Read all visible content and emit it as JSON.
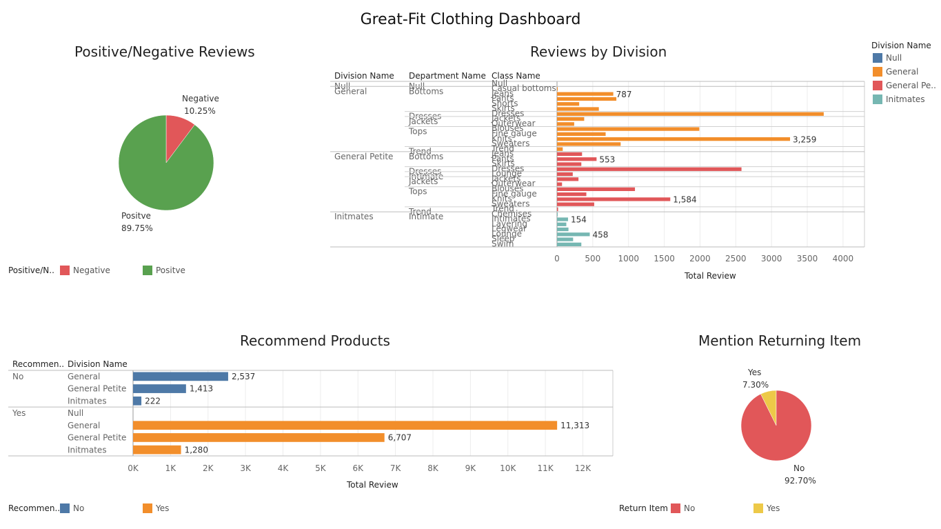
{
  "dashboard_title": "Great-Fit Clothing Dashboard",
  "colors": {
    "null": "#4e79a7",
    "general": "#f28e2b",
    "petite": "#e15759",
    "intimates": "#76b7b2",
    "positive": "#59a14f",
    "negative": "#e15759",
    "yes_return": "#edc948"
  },
  "division_legend": {
    "title": "Division Name",
    "items": [
      {
        "label": "Null",
        "color": "#4e79a7"
      },
      {
        "label": "General",
        "color": "#f28e2b"
      },
      {
        "label": "General Pe..",
        "color": "#e15759"
      },
      {
        "label": "Initmates",
        "color": "#76b7b2"
      }
    ]
  },
  "chart_data": [
    {
      "id": "pos_neg",
      "type": "pie",
      "title": "Positive/Negative Reviews",
      "slices": [
        {
          "label": "Negative",
          "value": 10.25,
          "display": "10.25%",
          "color": "#e15759"
        },
        {
          "label": "Positve",
          "value": 89.75,
          "display": "89.75%",
          "color": "#59a14f"
        }
      ],
      "legend": {
        "title": "Positive/N..",
        "items": [
          {
            "label": "Negative",
            "color": "#e15759"
          },
          {
            "label": "Positve",
            "color": "#59a14f"
          }
        ]
      }
    },
    {
      "id": "division",
      "type": "bar",
      "title": "Reviews by Division",
      "headers": [
        "Division Name",
        "Department Name",
        "Class Name"
      ],
      "xlabel": "Total Review",
      "xlim": [
        0,
        4300
      ],
      "ticks": [
        0,
        500,
        1000,
        1500,
        2000,
        2500,
        3000,
        3500,
        4000
      ],
      "divisions": [
        {
          "name": "Null",
          "color": "#4e79a7",
          "departments": [
            {
              "name": "Null",
              "classes": [
                {
                  "name": "Null",
                  "value": 0
                }
              ]
            }
          ]
        },
        {
          "name": "General",
          "color": "#f28e2b",
          "departments": [
            {
              "name": "Bottoms",
              "classes": [
                {
                  "name": "Casual bottoms",
                  "value": 2
                },
                {
                  "name": "Jeans",
                  "value": 787,
                  "label": "787"
                },
                {
                  "name": "Pants",
                  "value": 830
                },
                {
                  "name": "Shorts",
                  "value": 310
                },
                {
                  "name": "Skirts",
                  "value": 585
                }
              ]
            },
            {
              "name": "Dresses",
              "classes": [
                {
                  "name": "Dresses",
                  "value": 3730
                }
              ]
            },
            {
              "name": "Jackets",
              "classes": [
                {
                  "name": "Jackets",
                  "value": 380
                },
                {
                  "name": "Outerwear",
                  "value": 240
                }
              ]
            },
            {
              "name": "Tops",
              "classes": [
                {
                  "name": "Blouses",
                  "value": 1990
                },
                {
                  "name": "Fine gauge",
                  "value": 680
                },
                {
                  "name": "Knits",
                  "value": 3259,
                  "label": "3,259"
                },
                {
                  "name": "Sweaters",
                  "value": 890
                }
              ]
            },
            {
              "name": "Trend",
              "classes": [
                {
                  "name": "Trend",
                  "value": 80
                }
              ]
            }
          ]
        },
        {
          "name": "General Petite",
          "color": "#e15759",
          "departments": [
            {
              "name": "Bottoms",
              "classes": [
                {
                  "name": "Jeans",
                  "value": 350
                },
                {
                  "name": "Pants",
                  "value": 553,
                  "label": "553"
                },
                {
                  "name": "Skirts",
                  "value": 340
                }
              ]
            },
            {
              "name": "Dresses",
              "classes": [
                {
                  "name": "Dresses",
                  "value": 2580
                }
              ]
            },
            {
              "name": "Intimate",
              "classes": [
                {
                  "name": "Lounge",
                  "value": 220
                }
              ]
            },
            {
              "name": "Jackets",
              "classes": [
                {
                  "name": "Jackets",
                  "value": 300
                },
                {
                  "name": "Outerwear",
                  "value": 70
                }
              ]
            },
            {
              "name": "Tops",
              "classes": [
                {
                  "name": "Blouses",
                  "value": 1090
                },
                {
                  "name": "Fine gauge",
                  "value": 410
                },
                {
                  "name": "Knits",
                  "value": 1584,
                  "label": "1,584"
                },
                {
                  "name": "Sweaters",
                  "value": 520
                }
              ]
            },
            {
              "name": "Trend",
              "classes": [
                {
                  "name": "Trend",
                  "value": 15
                }
              ]
            }
          ]
        },
        {
          "name": "Initmates",
          "color": "#76b7b2",
          "departments": [
            {
              "name": "Intimate",
              "classes": [
                {
                  "name": "Chemises",
                  "value": 2
                },
                {
                  "name": "Intimates",
                  "value": 154,
                  "label": "154"
                },
                {
                  "name": "Layering",
                  "value": 130
                },
                {
                  "name": "Legwear",
                  "value": 160
                },
                {
                  "name": "Lounge",
                  "value": 458,
                  "label": "458"
                },
                {
                  "name": "Sleep",
                  "value": 225
                },
                {
                  "name": "Swim",
                  "value": 340
                }
              ]
            }
          ]
        }
      ]
    },
    {
      "id": "recommend",
      "type": "bar",
      "title": "Recommend Products",
      "headers": [
        "Recommen..",
        "Division Name"
      ],
      "xlabel": "Total Review",
      "xlim": [
        0,
        12800
      ],
      "ticks": [
        0,
        1000,
        2000,
        3000,
        4000,
        5000,
        6000,
        7000,
        8000,
        9000,
        10000,
        11000,
        12000
      ],
      "tick_labels": [
        "0K",
        "1K",
        "2K",
        "3K",
        "4K",
        "5K",
        "6K",
        "7K",
        "8K",
        "9K",
        "10K",
        "11K",
        "12K"
      ],
      "groups": [
        {
          "name": "No",
          "color": "#4e79a7",
          "rows": [
            {
              "division": "General",
              "value": 2537,
              "label": "2,537"
            },
            {
              "division": "General Petite",
              "value": 1413,
              "label": "1,413"
            },
            {
              "division": "Initmates",
              "value": 222,
              "label": "222"
            }
          ]
        },
        {
          "name": "Yes",
          "color": "#f28e2b",
          "rows": [
            {
              "division": "Null",
              "value": 0
            },
            {
              "division": "General",
              "value": 11313,
              "label": "11,313"
            },
            {
              "division": "General Petite",
              "value": 6707,
              "label": "6,707"
            },
            {
              "division": "Initmates",
              "value": 1280,
              "label": "1,280"
            }
          ]
        }
      ],
      "legend": {
        "title": "Recommen..",
        "items": [
          {
            "label": "No",
            "color": "#4e79a7"
          },
          {
            "label": "Yes",
            "color": "#f28e2b"
          }
        ]
      }
    },
    {
      "id": "returning",
      "type": "pie",
      "title": "Mention Returning Item",
      "slices": [
        {
          "label": "Yes",
          "value": 7.3,
          "display": "7.30%",
          "color": "#edc948"
        },
        {
          "label": "No",
          "value": 92.7,
          "display": "92.70%",
          "color": "#e15759"
        }
      ],
      "legend": {
        "title": "Return Item",
        "items": [
          {
            "label": "No",
            "color": "#e15759"
          },
          {
            "label": "Yes",
            "color": "#edc948"
          }
        ]
      }
    }
  ]
}
